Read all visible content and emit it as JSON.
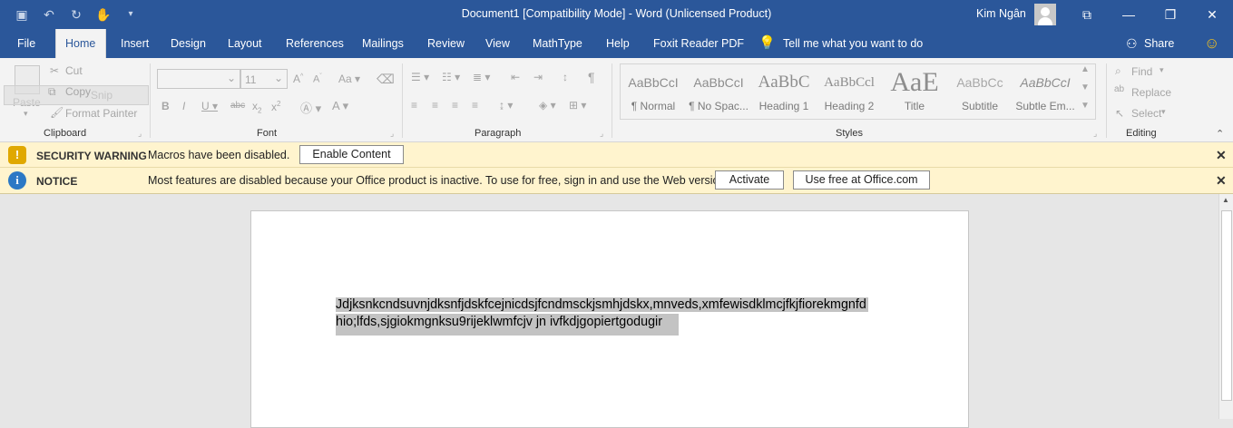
{
  "title": "Document1 [Compatibility Mode]  -  Word (Unlicensed Product)",
  "user": "Kim Ngân",
  "tabs": [
    "File",
    "Home",
    "Insert",
    "Design",
    "Layout",
    "References",
    "Mailings",
    "Review",
    "View",
    "MathType",
    "Help",
    "Foxit Reader PDF"
  ],
  "tell_me": "Tell me what you want to do",
  "share": "Share",
  "clipboard": {
    "paste": "Paste",
    "cut": "Cut",
    "copy": "Copy",
    "snip": "Snip",
    "format_painter": "Format Painter",
    "label": "Clipboard"
  },
  "font": {
    "size": "11",
    "label": "Font"
  },
  "paragraph": {
    "label": "Paragraph"
  },
  "styles": {
    "label": "Styles",
    "items": [
      {
        "preview": "AaBbCcI",
        "name": "¶ Normal"
      },
      {
        "preview": "AaBbCcI",
        "name": "¶ No Spac..."
      },
      {
        "preview": "AaBbC",
        "name": "Heading 1"
      },
      {
        "preview": "AaBbCcl",
        "name": "Heading 2"
      },
      {
        "preview": "AaE",
        "name": "Title"
      },
      {
        "preview": "AaBbCc",
        "name": "Subtitle"
      },
      {
        "preview": "AaBbCcI",
        "name": "Subtle Em..."
      }
    ]
  },
  "editing": {
    "find": "Find",
    "replace": "Replace",
    "select": "Select",
    "label": "Editing"
  },
  "security": {
    "title": "SECURITY WARNING",
    "text": "Macros have been disabled.",
    "button": "Enable Content"
  },
  "notice": {
    "title": "NOTICE",
    "text": "Most features are disabled because your Office product is inactive. To use for free, sign in and use the Web version.",
    "activate": "Activate",
    "use_free": "Use free at Office.com"
  },
  "document": {
    "line1": "Jdjksnkcndsuvnjdksnfjdskfcejnicdsjfcndmsckjsmhjdskx,mnveds,xmfewisdklmcjfkjfiorekmgnfd",
    "line2": "hio;lfds,sjgiokmgnksu9rijeklwmfcjv jn ivfkdjgopiertgodugir"
  }
}
